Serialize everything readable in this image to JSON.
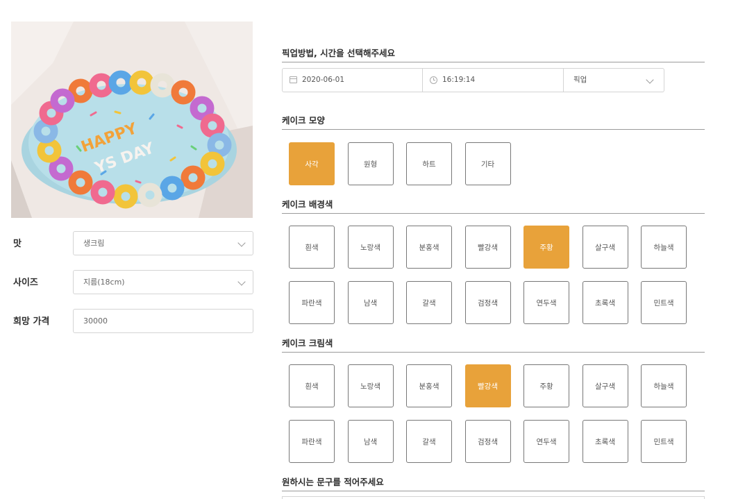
{
  "product": {
    "fields": [
      {
        "label": "맛",
        "value": "생크림",
        "dropdown": true
      },
      {
        "label": "사이즈",
        "value": "지름(18cm)",
        "dropdown": true
      },
      {
        "label": "희망 가격",
        "value": "30000",
        "dropdown": false
      }
    ]
  },
  "pickup": {
    "title": "픽업방법, 시간을 선택해주세요",
    "date": "2020-06-01",
    "time": "16:19:14",
    "method": "픽업"
  },
  "shape": {
    "title": "케이크 모양",
    "options": [
      "사각",
      "원형",
      "하트",
      "기타"
    ],
    "selected": "사각"
  },
  "background": {
    "title": "케이크 배경색",
    "options": [
      "흰색",
      "노랑색",
      "분홍색",
      "빨강색",
      "주황",
      "살구색",
      "하늘색",
      "파란색",
      "남색",
      "갈색",
      "검정색",
      "연두색",
      "초록색",
      "민트색"
    ],
    "selected": "주황"
  },
  "cream": {
    "title": "케이크 크림색",
    "options": [
      "흰색",
      "노랑색",
      "분홍색",
      "빨강색",
      "주황",
      "살구색",
      "하늘색",
      "파란색",
      "남색",
      "갈색",
      "검정색",
      "연두색",
      "초록색",
      "민트색"
    ],
    "selected": "빨강색"
  },
  "message": {
    "title": "원하시는 문구를 적어주세요"
  },
  "colors": {
    "accent": "#e8a23a"
  }
}
